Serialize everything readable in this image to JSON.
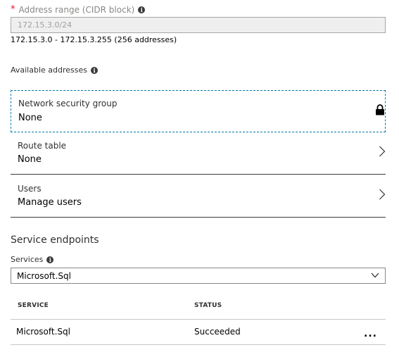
{
  "address_range": {
    "required_marker": "*",
    "label": "Address range (CIDR block)",
    "value": "172.15.3.0/24",
    "range_text": "172.15.3.0 - 172.15.3.255 (256 addresses)"
  },
  "available_addresses": {
    "label": "Available addresses"
  },
  "network_security_group": {
    "label": "Network security group",
    "value": "None"
  },
  "route_table": {
    "label": "Route table",
    "value": "None"
  },
  "users": {
    "label": "Users",
    "value": "Manage users"
  },
  "service_endpoints": {
    "title": "Service endpoints",
    "services_label": "Services",
    "selected": "Microsoft.Sql",
    "table": {
      "columns": [
        "SERVICE",
        "STATUS"
      ],
      "rows": [
        {
          "service": "Microsoft.Sql",
          "status": "Succeeded",
          "more": "..."
        }
      ]
    }
  },
  "icons": {
    "info": "info-icon",
    "lock": "lock-icon",
    "chevron": "chevron-right-icon",
    "dropdown": "chevron-down-icon",
    "more": "more-icon"
  },
  "colors": {
    "required": "#e81123",
    "focus_border": "#0078a8"
  }
}
